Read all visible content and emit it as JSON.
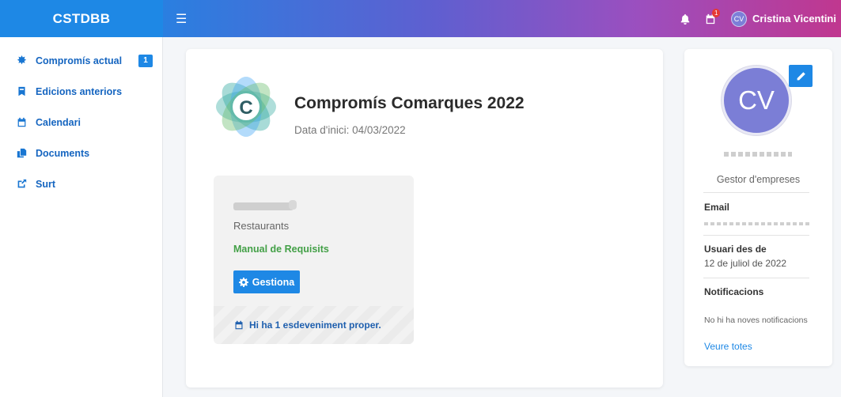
{
  "header": {
    "brand": "CSTDBB",
    "menu_icon": "hamburger-icon",
    "notifications_icon": "bell-icon",
    "calendar_icon": "calendar-icon",
    "calendar_badge": "1",
    "user_initials": "CV",
    "user_name": "Cristina Vicentini"
  },
  "sidebar": {
    "items": [
      {
        "label": "Compromís actual",
        "icon": "sun-icon",
        "badge": "1"
      },
      {
        "label": "Edicions anteriors",
        "icon": "bookmark-icon"
      },
      {
        "label": "Calendari",
        "icon": "calendar-icon"
      },
      {
        "label": "Documents",
        "icon": "documents-icon"
      },
      {
        "label": "Surt",
        "icon": "logout-icon"
      }
    ]
  },
  "campaign": {
    "logo_letter": "C",
    "title": "Compromís Comarques 2022",
    "start_date": "Data d'inici: 04/03/2022"
  },
  "company": {
    "sector": "Restaurants",
    "manual_link": "Manual de Requisits",
    "manage_button": "Gestiona",
    "event_notice": "Hi ha 1 esdeveniment proper."
  },
  "profile": {
    "initials": "CV",
    "role": "Gestor d'empreses",
    "email_label": "Email",
    "member_since_label": "Usuari des de",
    "member_since_value": "12 de juliol de 2022",
    "notifications_label": "Notificacions",
    "notifications_empty": "No hi ha noves notificacions",
    "see_all": "Veure totes"
  },
  "colors": {
    "primary": "#1e88e5",
    "success": "#43a047",
    "avatar": "#7b7ed6"
  }
}
